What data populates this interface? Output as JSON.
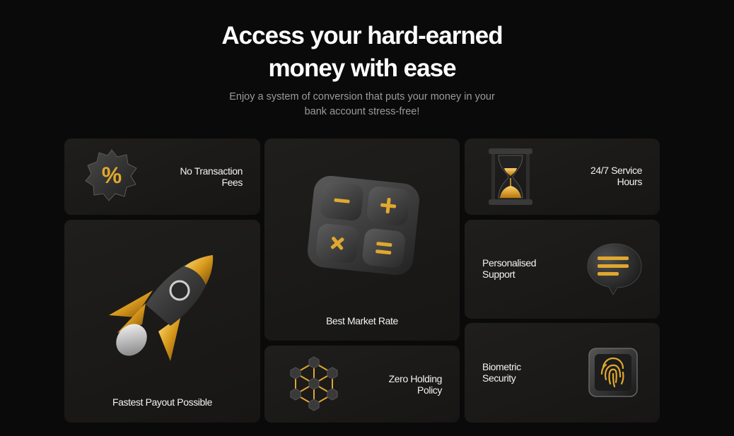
{
  "hero": {
    "title_line1": "Access your hard-earned",
    "title_line2": "money with ease",
    "subtitle_line1": "Enjoy a system of conversion that puts your money in your",
    "subtitle_line2": "bank account stress-free!"
  },
  "features": {
    "no_fees": {
      "line1": "No Transaction",
      "line2": "Fees",
      "icon": "percent-badge-icon"
    },
    "payout": {
      "label": "Fastest Payout Possible",
      "icon": "rocket-icon"
    },
    "market_rate": {
      "label": "Best Market Rate",
      "icon": "calculator-icon"
    },
    "zero_holding": {
      "line1": "Zero Holding",
      "line2": "Policy",
      "icon": "hexagon-network-icon"
    },
    "service_hours": {
      "line1": "24/7 Service",
      "line2": "Hours",
      "icon": "hourglass-icon"
    },
    "support": {
      "line1": "Personalised",
      "line2": "Support",
      "icon": "chat-bubble-icon"
    },
    "security": {
      "line1": "Biometric",
      "line2": "Security",
      "icon": "fingerprint-icon"
    }
  },
  "colors": {
    "background": "#0a0a0a",
    "card": "#1c1b19",
    "accent_gold": "#e0a82e",
    "text_muted": "#9a9a9a"
  }
}
